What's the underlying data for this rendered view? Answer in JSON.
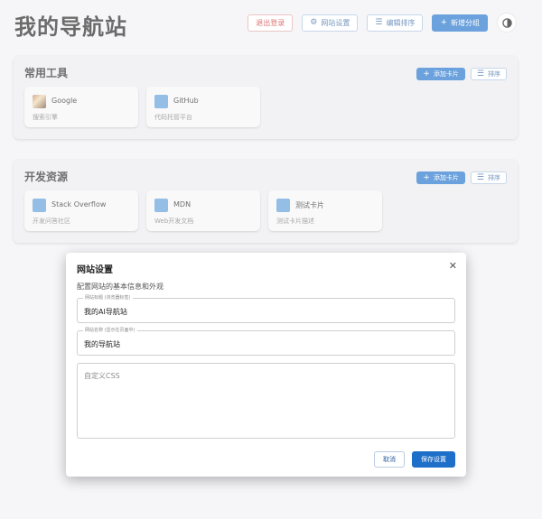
{
  "header": {
    "title": "我的导航站",
    "logout_label": "退出登录",
    "settings_label": "网站设置",
    "sort_label": "编辑排序",
    "add_group_label": "新增分组"
  },
  "icons": {
    "settings": "gear-icon",
    "sort": "sort-icon",
    "add": "plus-icon",
    "theme": "contrast-icon",
    "close": "close-icon"
  },
  "colors": {
    "primary": "#1d6fc9",
    "danger": "#c92a2a",
    "card_icon": "#5b9bd9"
  },
  "groups": [
    {
      "title": "常用工具",
      "add_card_label": "添加卡片",
      "sort_label": "排序",
      "cards": [
        {
          "name": "Google",
          "desc": "搜索引擎"
        },
        {
          "name": "GitHub",
          "desc": "代码托管平台"
        }
      ]
    },
    {
      "title": "开发资源",
      "add_card_label": "添加卡片",
      "sort_label": "排序",
      "cards": [
        {
          "name": "Stack Overflow",
          "desc": "开发问答社区"
        },
        {
          "name": "MDN",
          "desc": "Web开发文档"
        },
        {
          "name": "测试卡片",
          "desc": "测试卡片描述"
        }
      ]
    }
  ],
  "modal": {
    "title": "网站设置",
    "subtitle": "配置网站的基本信息和外观",
    "site_title_legend": "网站标题 (浏览器标签)",
    "site_title_value": "我的AI导航站",
    "site_name_legend": "网站名称 (显示在页面中)",
    "site_name_value": "我的导航站",
    "css_placeholder": "自定义CSS",
    "cancel_label": "取消",
    "save_label": "保存设置"
  }
}
